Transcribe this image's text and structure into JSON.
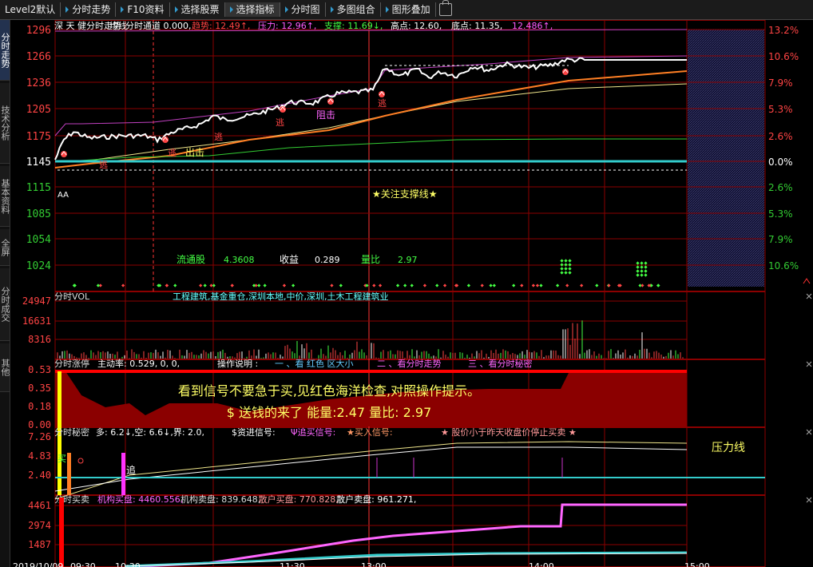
{
  "toolbar": {
    "buttons": [
      "Level2默认",
      "分时走势",
      "F10资料",
      "选择股票",
      "选择指标",
      "分时图",
      "多图组合",
      "图形叠加"
    ],
    "active": "选择指标"
  },
  "side_tabs": [
    "分时走势",
    "技术分析",
    "基本资料",
    "全屏",
    "分时成交",
    "其他"
  ],
  "price_panel": {
    "title_parts": [
      {
        "text": "深 天 健分时走势",
        "color": "#ffffff"
      },
      {
        "text": "均线",
        "color": "#ffffff"
      },
      {
        "text": "分时通道 0.000,",
        "color": "#ffffff"
      },
      {
        "text": "趋势: 12.49↑,",
        "color": "#ff4444"
      },
      {
        "text": "压力: 12.96↑,",
        "color": "#ff5cff"
      },
      {
        "text": "支撑: 11.69↓,",
        "color": "#44ff44"
      },
      {
        "text": "高点: 12.60,",
        "color": "#ffffff"
      },
      {
        "text": "底点: 11.35,",
        "color": "#ffffff"
      },
      {
        "text": "12.486↑,",
        "color": "#ff5cff"
      }
    ],
    "left_axis": [
      "1296",
      "1266",
      "1236",
      "1205",
      "1175",
      "1145",
      "1115",
      "1085",
      "1054",
      "1024"
    ],
    "right_axis": [
      "13.2%",
      "10.6%",
      "7.9%",
      "5.3%",
      "2.6%",
      "0.0%",
      "2.6%",
      "5.3%",
      "7.9%",
      "10.6%"
    ],
    "notes": {
      "chuji": "出击",
      "zuji": "阻击",
      "tao": "逃",
      "aa": "AA",
      "support": "★关注支撑线★"
    },
    "stats": {
      "liutong_label": "流通股",
      "liutong_value": "4.3608",
      "shouyi_label": "收益",
      "shouyi_value": "0.289",
      "liangbi_label": "量比",
      "liangbi_value": "2.97"
    }
  },
  "vol_panel": {
    "title": "分时VOL",
    "tags": "工程建筑,基金重仓,深圳本地,中价,深圳,土木工程建筑业",
    "axis": [
      "24947",
      "16631",
      "8316"
    ]
  },
  "zhangting_panel": {
    "title": "分时涨停",
    "zhudong": "主动率: 0.529, 0, 0,",
    "caozuo": "操作说明 :",
    "items": [
      "一 、看 红色 区大小",
      "二 、看分时走势",
      "三 、看分时秘密"
    ],
    "axis": [
      "0.53",
      "0.35",
      "0.18",
      "0.00"
    ],
    "banner_line1": "看到信号不要急于买,见红色海洋检查,对照操作提示。",
    "banner_line2": "$  送钱的来了 能量:2.47   量比: 2.97"
  },
  "mimi_panel": {
    "title": "分时秘密",
    "params": "多: 6.2↓,空: 6.6↓,界: 2.0,",
    "zijin": "$资进信号:",
    "zhui": "Ψ追买信号:",
    "buy": "★买入信号:",
    "stop": "★ 股价小于昨天收盘价停止买卖 ★",
    "axis": [
      "7.26",
      "4.83",
      "2.40"
    ],
    "yali": "压力线",
    "zhui_label": "追",
    "mai_label": "买"
  },
  "maimai_panel": {
    "title": "分时买卖",
    "parts": [
      {
        "text": "机构买盘: 4460.556,",
        "color": "#ff66ff"
      },
      {
        "text": "机构卖盘: 839.648,",
        "color": "#dddddd"
      },
      {
        "text": "散户买盘: 770.828,",
        "color": "#ff9999"
      },
      {
        "text": "散户卖盘: 961.271,",
        "color": "#ffffff"
      }
    ],
    "axis": [
      "4461",
      "2974",
      "1487"
    ]
  },
  "time_axis": [
    "2019/10/09",
    "09:30",
    "10:30",
    "11:30",
    "13:00",
    "14:00",
    "15:00"
  ],
  "colors": {
    "grid": "#8b0000",
    "price_line": "#ffffff",
    "avg_line": "#f0e68c",
    "trend": "#ff7f24",
    "pressure": "#c040c0",
    "support": "#33cc33",
    "zero": "#33cccc"
  }
}
